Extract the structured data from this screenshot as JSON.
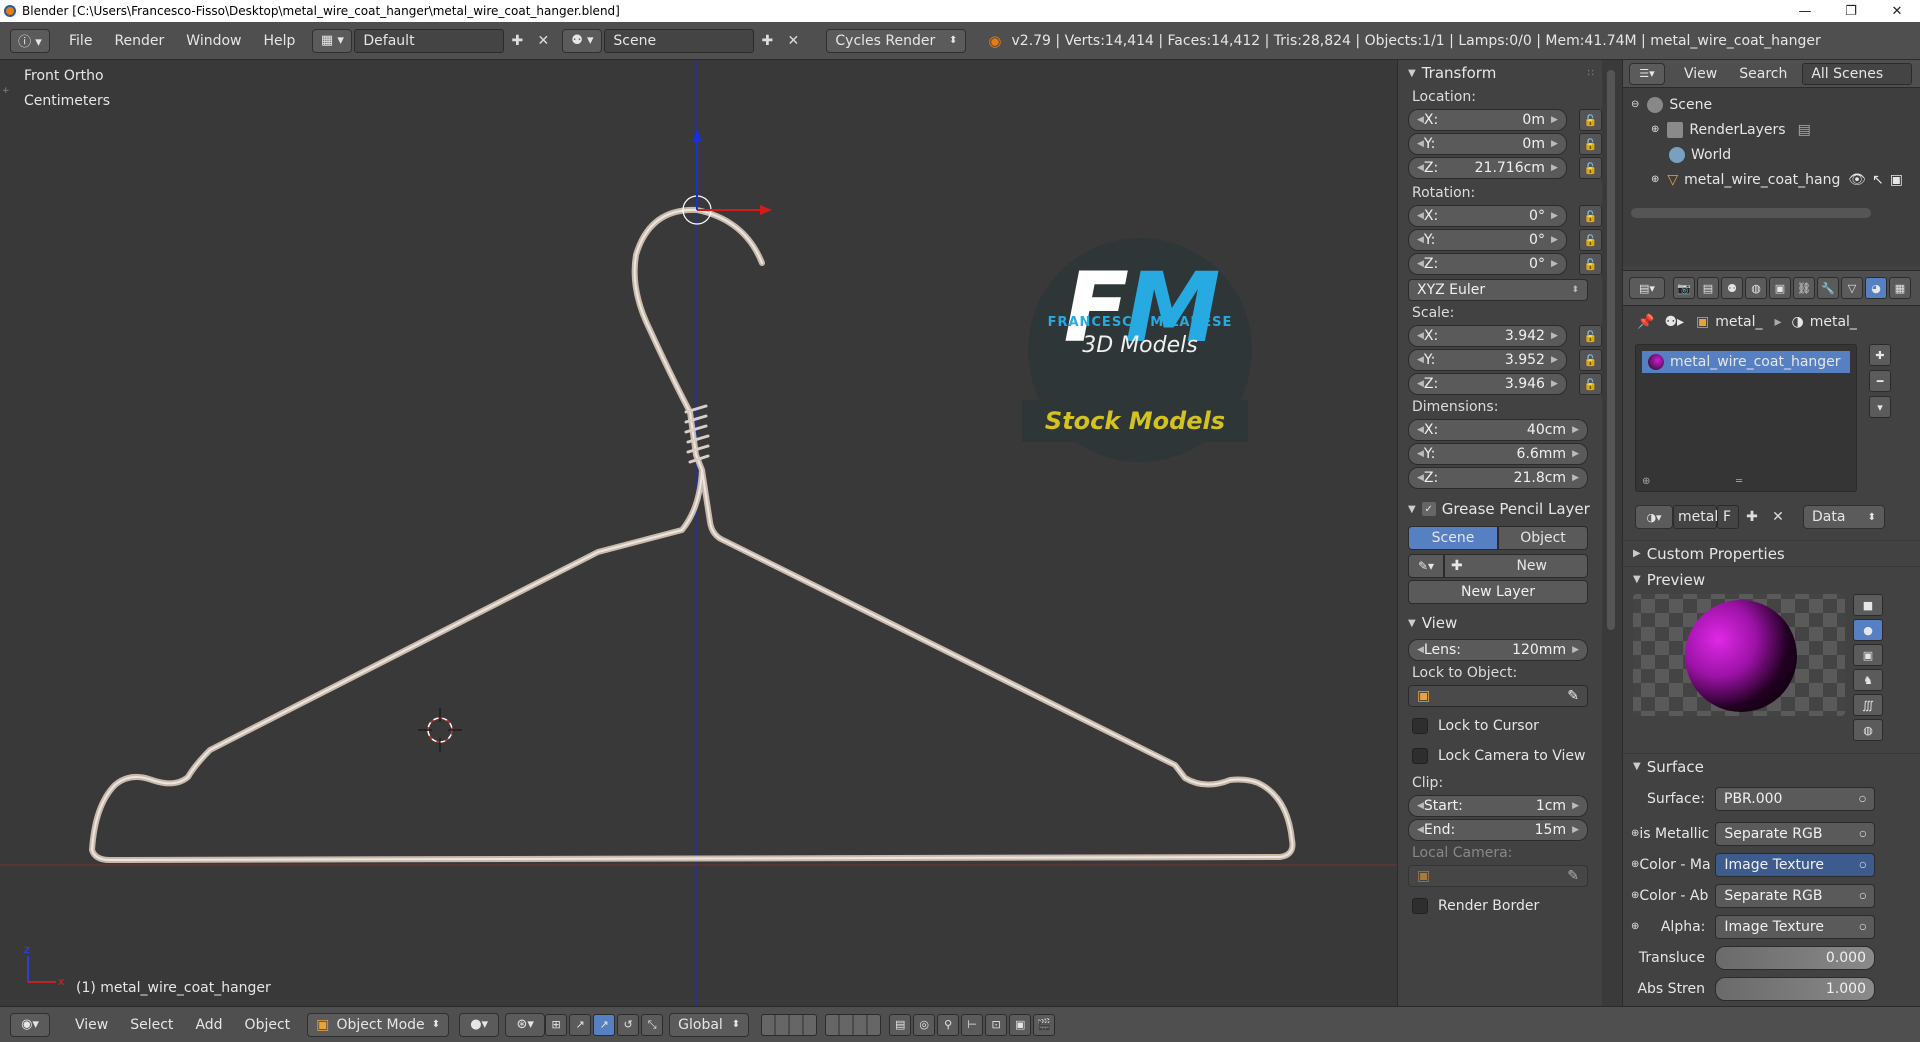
{
  "window": {
    "title": "Blender [C:\\Users\\Francesco-Fisso\\Desktop\\metal_wire_coat_hanger\\metal_wire_coat_hanger.blend]",
    "minimize": "—",
    "maximize": "❐",
    "close": "✕"
  },
  "menubar": {
    "items": [
      "File",
      "Render",
      "Window",
      "Help"
    ],
    "layout": "Default",
    "scene": "Scene",
    "engine": "Cycles Render",
    "stats": "v2.79 | Verts:14,414 | Faces:14,412 | Tris:28,824 | Objects:1/1 | Lamps:0/0 | Mem:41.74M | metal_wire_coat_hanger"
  },
  "viewport": {
    "view_name": "Front Ortho",
    "units": "Centimeters",
    "object_label": "(1) metal_wire_coat_hanger",
    "logo_letters": "FM",
    "logo_name": "FRANCESCO MILANESE",
    "logo_sub": "3D Models",
    "logo_banner": "Stock Models",
    "axis_x_color": "#c03030",
    "axis_z_color": "#2040c0"
  },
  "npanel": {
    "transform_title": "Transform",
    "location_label": "Location:",
    "location": [
      {
        "axis": "X:",
        "value": "0m"
      },
      {
        "axis": "Y:",
        "value": "0m"
      },
      {
        "axis": "Z:",
        "value": "21.716cm"
      }
    ],
    "rotation_label": "Rotation:",
    "rotation": [
      {
        "axis": "X:",
        "value": "0°"
      },
      {
        "axis": "Y:",
        "value": "0°"
      },
      {
        "axis": "Z:",
        "value": "0°"
      }
    ],
    "rotation_mode": "XYZ Euler",
    "scale_label": "Scale:",
    "scale": [
      {
        "axis": "X:",
        "value": "3.942"
      },
      {
        "axis": "Y:",
        "value": "3.952"
      },
      {
        "axis": "Z:",
        "value": "3.946"
      }
    ],
    "dimensions_label": "Dimensions:",
    "dimensions": [
      {
        "axis": "X:",
        "value": "40cm"
      },
      {
        "axis": "Y:",
        "value": "6.6mm"
      },
      {
        "axis": "Z:",
        "value": "21.8cm"
      }
    ],
    "grease_title": "Grease Pencil Layer",
    "grease_tabs": [
      "Scene",
      "Object"
    ],
    "grease_new": "New",
    "grease_new_layer": "New Layer",
    "view_title": "View",
    "lens_label": "Lens:",
    "lens_value": "120mm",
    "lock_to_object": "Lock to Object:",
    "lock_to_cursor": "Lock to Cursor",
    "lock_camera": "Lock Camera to View",
    "clip_label": "Clip:",
    "clip_start_label": "Start:",
    "clip_start": "1cm",
    "clip_end_label": "End:",
    "clip_end": "15m",
    "local_camera": "Local Camera:",
    "render_border": "Render Border"
  },
  "outliner": {
    "header": [
      "View",
      "Search",
      "All Scenes"
    ],
    "items": [
      {
        "label": "Scene"
      },
      {
        "label": "RenderLayers"
      },
      {
        "label": "World"
      },
      {
        "label": "metal_wire_coat_hang"
      }
    ]
  },
  "properties": {
    "breadcrumb": [
      "metal_",
      "metal_"
    ],
    "material_slot": "metal_wire_coat_hanger",
    "material_name": "metal",
    "material_f": "F",
    "data_select": "Data",
    "custom_properties": "Custom Properties",
    "preview": "Preview",
    "surface_title": "Surface",
    "surface_rows": [
      {
        "label": "Surface:",
        "value": "PBR.000"
      },
      {
        "label": "is Metallic",
        "value": "Separate RGB"
      },
      {
        "label": "Color - Ma",
        "value": "Image Texture"
      },
      {
        "label": "Color - Ab",
        "value": "Separate RGB"
      },
      {
        "label": "Alpha:",
        "value": "Image Texture"
      },
      {
        "label": "Transluce",
        "value": "0.000"
      },
      {
        "label": "Abs Stren",
        "value": "1.000"
      }
    ]
  },
  "bottombar": {
    "items": [
      "View",
      "Select",
      "Add",
      "Object"
    ],
    "mode": "Object Mode",
    "orientation": "Global"
  }
}
